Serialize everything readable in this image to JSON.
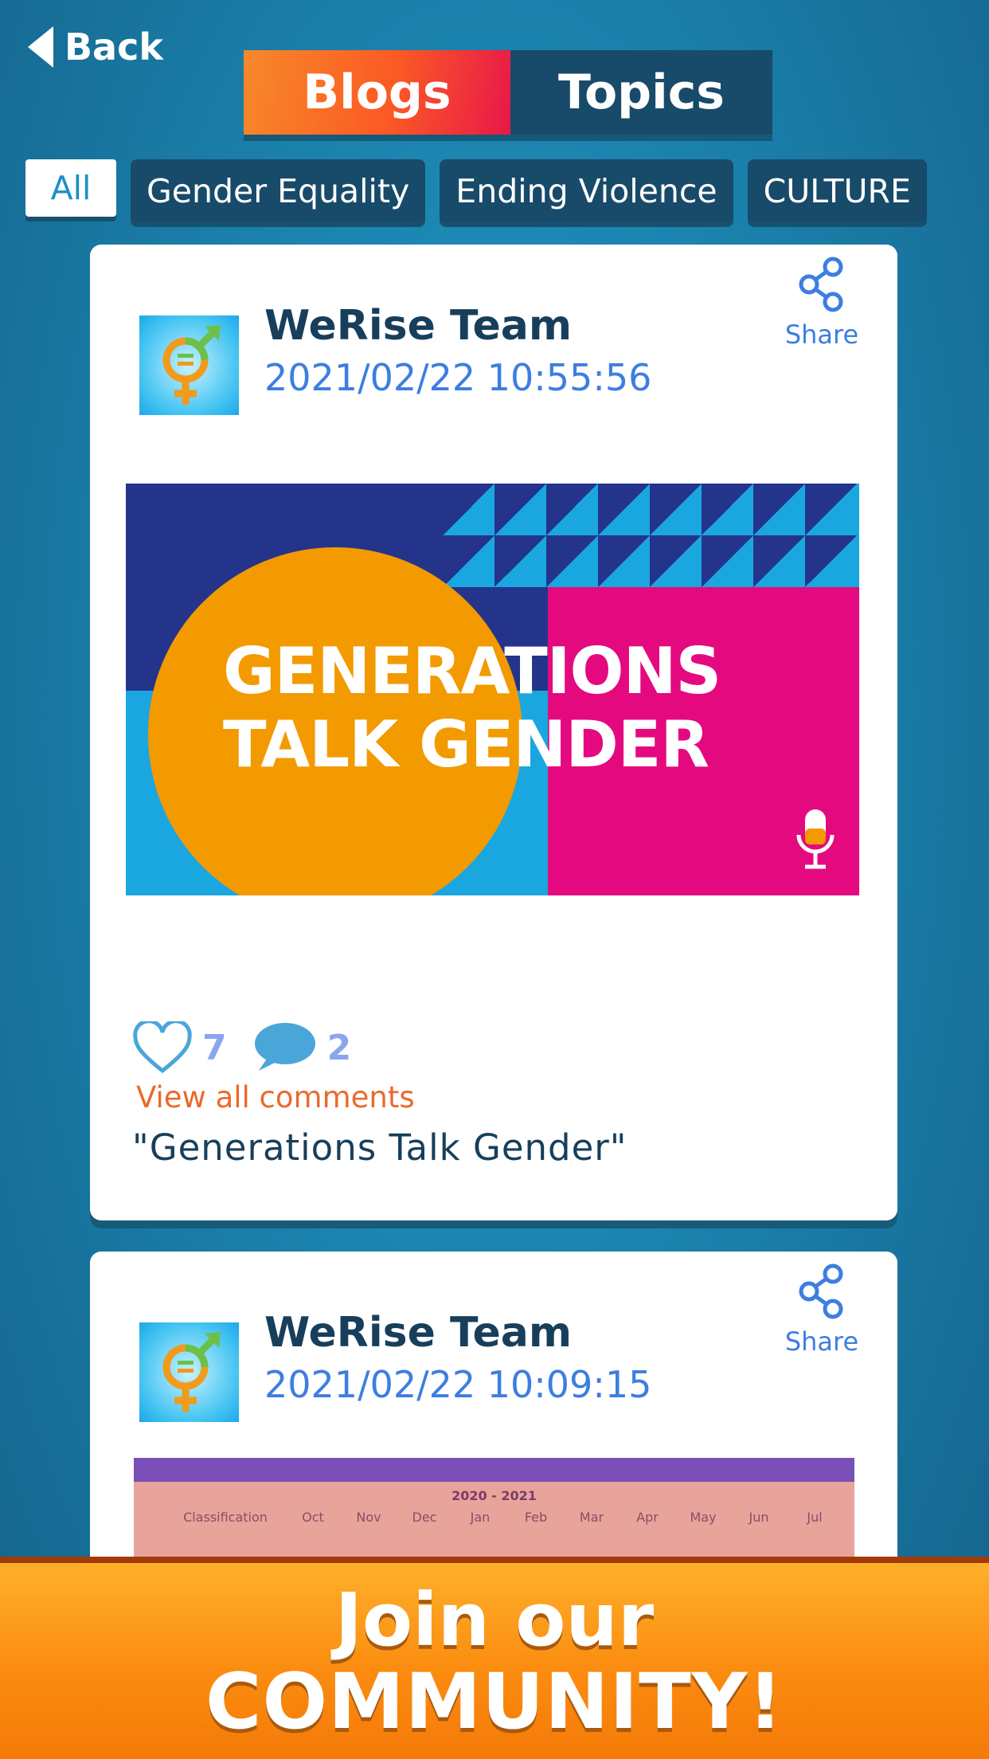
{
  "nav": {
    "back_label": "Back",
    "tabs": [
      {
        "label": "Blogs",
        "active": true
      },
      {
        "label": "Topics",
        "active": false
      }
    ]
  },
  "filters": [
    {
      "label": "All",
      "selected": true
    },
    {
      "label": "Gender Equality"
    },
    {
      "label": "Ending Violence"
    },
    {
      "label": "CULTURE"
    }
  ],
  "posts": [
    {
      "author": "WeRise Team",
      "date": "2021/02/22 10:55:56",
      "share_label": "Share",
      "image_text_line1": "GENERATIONS",
      "image_text_line2": "TALK GENDER",
      "likes": "7",
      "comments": "2",
      "view_comments_label": "View all comments",
      "title": "\"Generations Talk Gender\""
    },
    {
      "author": "WeRise Team",
      "date": "2021/02/22 10:09:15",
      "share_label": "Share",
      "image_months": [
        "Classification",
        "Oct",
        "Nov",
        "Dec",
        "Jan",
        "Feb",
        "Mar",
        "Apr",
        "May",
        "Jun",
        "Jul"
      ],
      "image_year": "2020 - 2021"
    }
  ],
  "banner": {
    "line1": "Join our",
    "line2": "COMMUNITY!"
  },
  "colors": {
    "accent_orange": "#f7892a",
    "tab_dark": "#184a6a",
    "link_blue": "#3d7ee0",
    "comment_orange": "#ea6a2c"
  }
}
